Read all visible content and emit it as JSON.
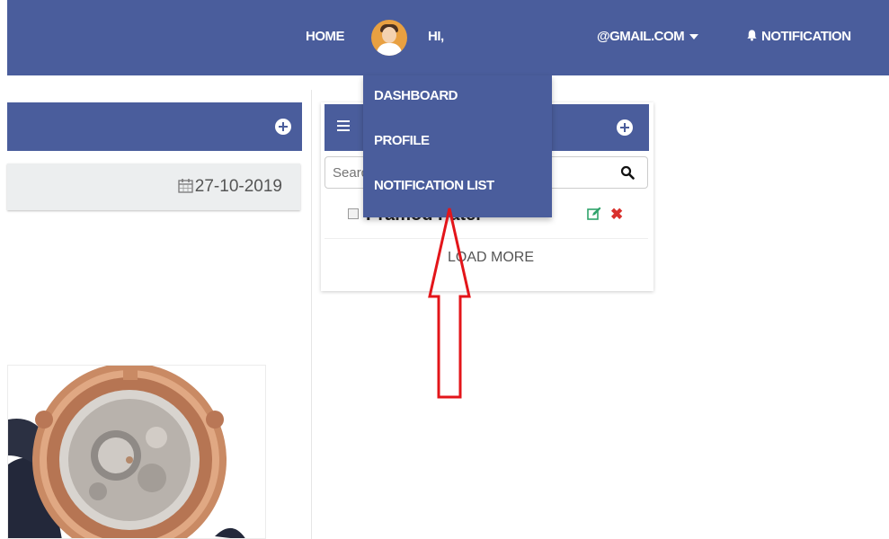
{
  "nav": {
    "home": "HOME",
    "greeting": "HI,",
    "email": "@GMAIL.COM",
    "notification": "NOTIFICATION"
  },
  "dropdown": {
    "items": [
      {
        "label": "DASHBOARD"
      },
      {
        "label": "PROFILE"
      },
      {
        "label": "NOTIFICATION LIST"
      }
    ]
  },
  "left_panel": {
    "date": "27-10-2019"
  },
  "todo": {
    "search_placeholder": "Search",
    "items": [
      {
        "text": "Pramod Patel",
        "checked": false
      }
    ],
    "load_more": "LOAD MORE"
  },
  "colors": {
    "primary": "#4a5d9c",
    "delete": "#d9302c",
    "edit": "#2fa36b",
    "arrow": "#e3151a"
  },
  "icons": [
    "user-avatar",
    "caret-down-icon",
    "bell-icon",
    "plus-circle-icon",
    "calendar-icon",
    "menu-icon",
    "search-icon",
    "edit-icon",
    "delete-icon",
    "up-arrow-annotation"
  ]
}
